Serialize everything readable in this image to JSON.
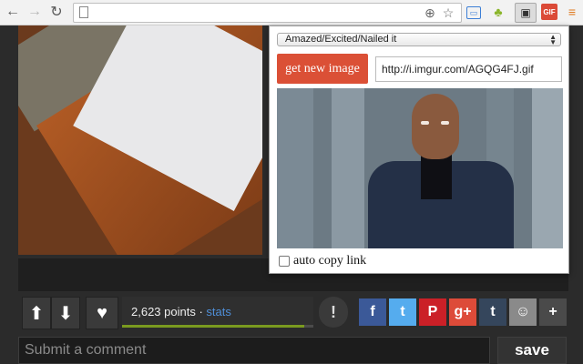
{
  "browser": {
    "back_icon": "arrow-left-icon",
    "forward_icon": "arrow-right-icon",
    "reload_icon": "reload-icon",
    "omnibox_value": "",
    "extensions": [
      "tab-icon",
      "android-icon",
      "cast-icon",
      "gif-extension-icon",
      "menu-icon"
    ],
    "gif_extension_label": "GIF"
  },
  "popup": {
    "category": "Amazed/Excited/Nailed it",
    "get_button_label": "get new image",
    "url": "http://i.imgur.com/AGQG4FJ.gif",
    "auto_copy_label": "auto copy link",
    "auto_copy_checked": false
  },
  "post": {
    "points_label": "2,623 points",
    "separator": " · ",
    "stats_label": "stats",
    "comment_placeholder": "Submit a comment",
    "save_label": "save",
    "share_buttons": [
      {
        "icon": "facebook-icon",
        "glyph": "f",
        "color": "#3b5998"
      },
      {
        "icon": "twitter-icon",
        "glyph": "t",
        "color": "#55acee"
      },
      {
        "icon": "pinterest-icon",
        "glyph": "P",
        "color": "#cb2027"
      },
      {
        "icon": "google-plus-icon",
        "glyph": "g+",
        "color": "#dd4b39"
      },
      {
        "icon": "tumblr-icon",
        "glyph": "t",
        "color": "#35465c"
      },
      {
        "icon": "reddit-icon",
        "glyph": "☺",
        "color": "#8a8a8a"
      },
      {
        "icon": "more-icon",
        "glyph": "+",
        "color": "#4a4a4a"
      }
    ]
  }
}
